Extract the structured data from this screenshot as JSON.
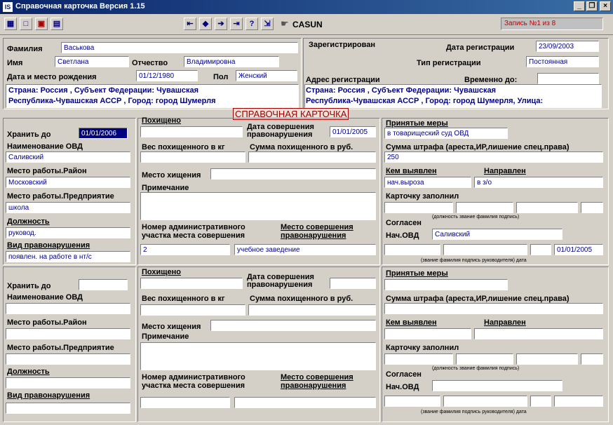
{
  "window": {
    "title": "Справочная карточка Версия 1.15",
    "app_icon": "app-icon",
    "buttons": {
      "minimize": "_",
      "restore": "❐",
      "close": "×"
    }
  },
  "toolbar": {
    "brand": "CASUN",
    "status": "Запись №1 из 8"
  },
  "person": {
    "surname_label": "Фамилия",
    "surname": "Васькова",
    "name_label": "Имя",
    "name": "Светлана",
    "patronymic_label": "Отчество",
    "patronymic": "Владимировна",
    "birth_label": "Дата и место рождения",
    "birth_date": "01/12/1980",
    "gender_label": "Пол",
    "gender": "Женский",
    "birth_address_line1": "Страна: Россия , Субъект Федерации: Чувашская",
    "birth_address_line2": "Республика-Чувашская АССР , Город: город Шумерля"
  },
  "registration": {
    "registered_label": "Зарегистрирован",
    "reg_date_label": "Дата регистрации",
    "reg_date": "23/09/2003",
    "reg_type_label": "Тип регистрации",
    "reg_type": "Постоянная",
    "reg_address_label": "Адрес регистрации",
    "temp_until_label": "Временно до:",
    "reg_address_line1": "Страна: Россия , Субъект Федерации: Чувашская",
    "reg_address_line2": "Республика-Чувашская АССР , Город: город Шумерля, Улица:"
  },
  "card_title": "СПРАВОЧНАЯ КАРТОЧКА",
  "labels": {
    "keep_until": "Хранить до",
    "ovd_name": "Наименование ОВД",
    "work_district": "Место работы.Район",
    "work_company": "Место работы.Предприятие",
    "position": "Должность",
    "offense_type": "Вид правонарушения",
    "stolen": "Похищено",
    "offense_date": "Дата совершения правонарушения",
    "stolen_weight": "Вес похищенного в кг",
    "stolen_sum": "Сумма похищенного в руб.",
    "location": "Место хищения",
    "notes": "Примечание",
    "admin_area_no": "Номер административного участка места совершения",
    "offense_place": "Место совершения правонарушения",
    "measures": "Принятые меры",
    "fine_sum": "Сумма штрафа (ареста,ИР,лишение спец.права)",
    "identified_by": "Кем выявлен",
    "sent_to": "Направлен",
    "card_filled": "Карточку заполнил",
    "sign_hint": "(должность звание фамилия подпись)",
    "agreed": "Согласен",
    "head_ovd": "Нач.ОВД",
    "sign_date_hint": "(звание фамилия подпись руководителя) дата"
  },
  "card1": {
    "keep_until": "01/01/2006",
    "ovd_name": "Саливский",
    "work_district": "Московский",
    "work_company": "школа",
    "position": "руковод.",
    "offense_type": "появлен. на работе в нт/с",
    "offense_date": "01/01/2005",
    "admin_area_no": "2",
    "offense_place": "учебное заведение",
    "measures": "в товарищеский суд ОВД",
    "fine_sum": "250",
    "identified_by": "нач.выроза",
    "sent_to": "в з/о",
    "head_ovd": "Саливский",
    "sign_date": "01/01/2005"
  }
}
